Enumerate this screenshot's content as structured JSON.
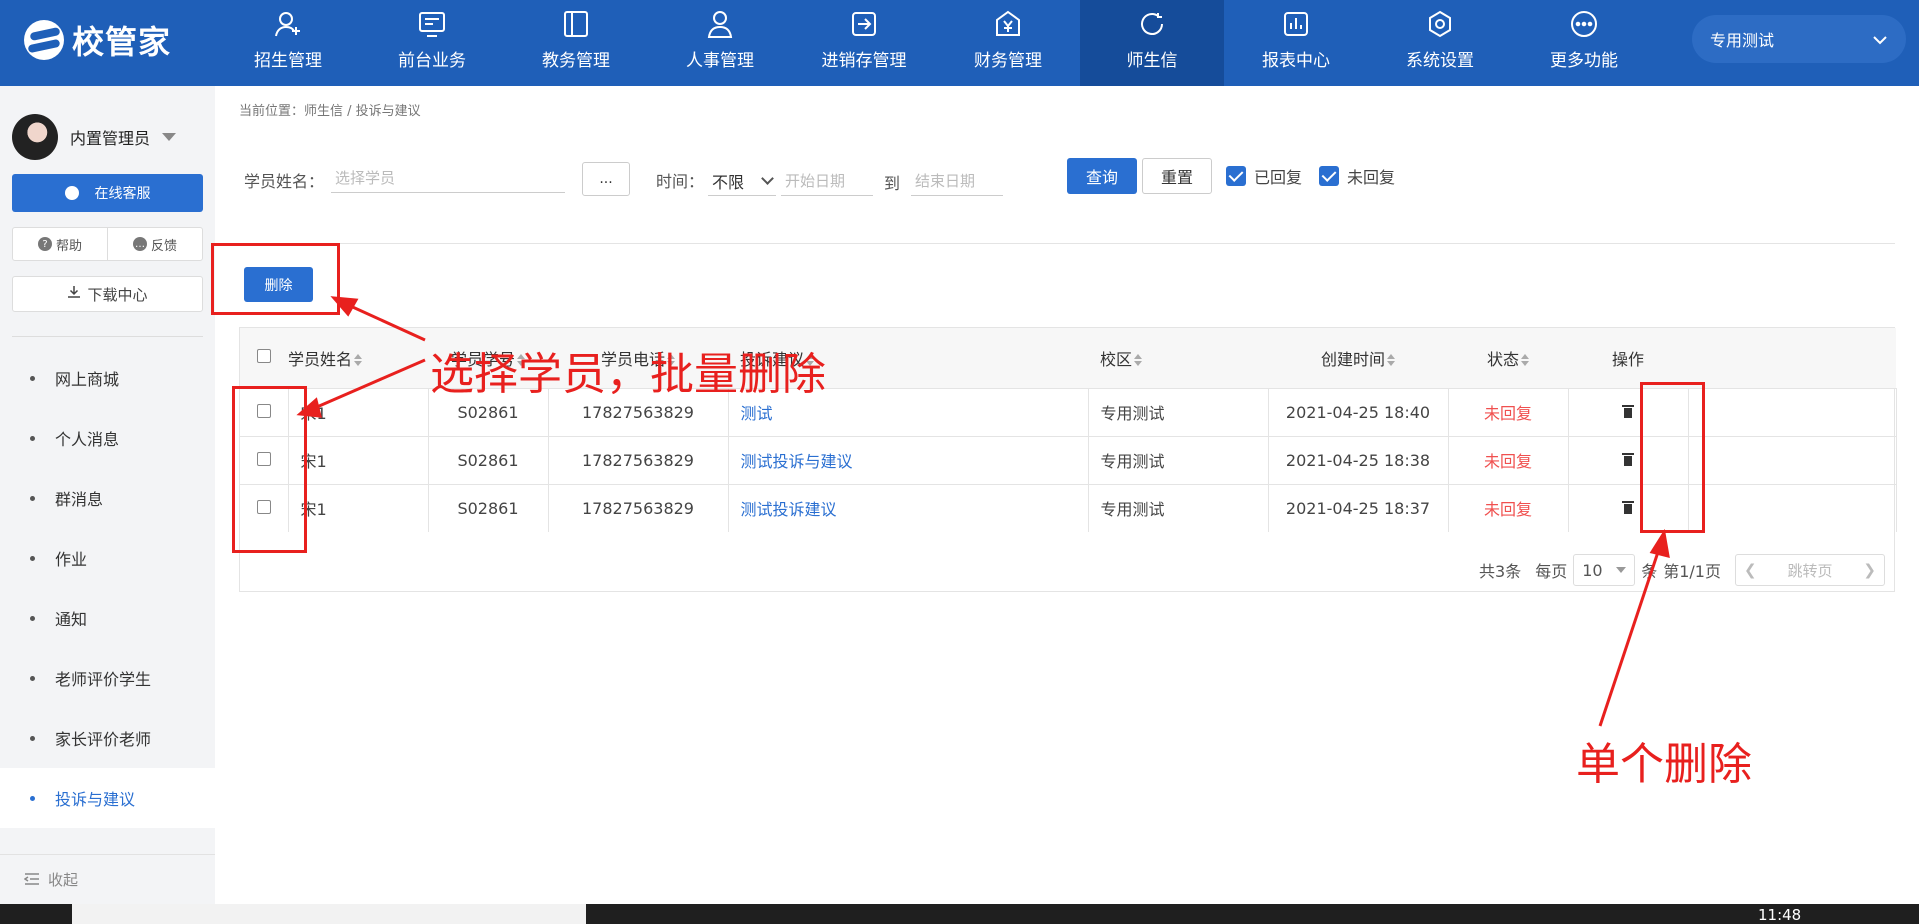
{
  "app": {
    "logo_text": "校管家"
  },
  "nav": [
    {
      "label": "招生管理",
      "icon": "person-add-icon"
    },
    {
      "label": "前台业务",
      "icon": "monitor-icon"
    },
    {
      "label": "教务管理",
      "icon": "book-icon"
    },
    {
      "label": "人事管理",
      "icon": "person-icon"
    },
    {
      "label": "进销存管理",
      "icon": "login-icon"
    },
    {
      "label": "财务管理",
      "icon": "yen-icon"
    },
    {
      "label": "师生信",
      "icon": "chat-icon"
    },
    {
      "label": "报表中心",
      "icon": "chart-icon"
    },
    {
      "label": "系统设置",
      "icon": "gear-icon"
    },
    {
      "label": "更多功能",
      "icon": "more-icon"
    }
  ],
  "campus": {
    "selected": "专用测试"
  },
  "sidebar": {
    "user_name": "内置管理员",
    "service_label": "在线客服",
    "help_label": "帮助",
    "feedback_label": "反馈",
    "download_label": "下载中心",
    "items": [
      {
        "label": "网上商城"
      },
      {
        "label": "个人消息"
      },
      {
        "label": "群消息"
      },
      {
        "label": "作业"
      },
      {
        "label": "通知"
      },
      {
        "label": "老师评价学生"
      },
      {
        "label": "家长评价老师"
      },
      {
        "label": "投诉与建议"
      }
    ],
    "collapse_label": "收起"
  },
  "breadcrumb": "当前位置：师生信 / 投诉与建议",
  "filter": {
    "student_label": "学员姓名：",
    "student_placeholder": "选择学员",
    "dots_label": "...",
    "time_label": "时间：",
    "time_value": "不限",
    "start_placeholder": "开始日期",
    "to_label": "到",
    "end_placeholder": "结束日期",
    "query_label": "查询",
    "reset_label": "重置",
    "replied_label": "已回复",
    "unreplied_label": "未回复"
  },
  "delete_label": "删除",
  "table": {
    "headers": [
      "学员姓名",
      "学员学号",
      "学员电话",
      "投诉建议",
      "校区",
      "创建时间",
      "状态",
      "操作"
    ],
    "rows": [
      {
        "name": "宋1",
        "no": "S02861",
        "phone": "17827563829",
        "content": "测试",
        "campus": "专用测试",
        "time": "2021-04-25 18:40",
        "status": "未回复"
      },
      {
        "name": "宋1",
        "no": "S02861",
        "phone": "17827563829",
        "content": "测试投诉与建议",
        "campus": "专用测试",
        "time": "2021-04-25 18:38",
        "status": "未回复"
      },
      {
        "name": "宋1",
        "no": "S02861",
        "phone": "17827563829",
        "content": "测试投诉建议",
        "campus": "专用测试",
        "time": "2021-04-25 18:37",
        "status": "未回复"
      }
    ]
  },
  "pager": {
    "total": "共3条",
    "per_page_label": "每页",
    "per_page_value": "10",
    "unit": "条",
    "page_info": "第1/1页",
    "jump_label": "跳转页"
  },
  "annotations": {
    "batch_text": "选择学员，批量删除",
    "single_text": "单个删除"
  },
  "taskbar": {
    "clock": "11:48"
  },
  "colors": {
    "brand": "#1f5fb8",
    "primary": "#2a6fd1",
    "annotation": "#e8201e",
    "status": "#f0504f"
  }
}
